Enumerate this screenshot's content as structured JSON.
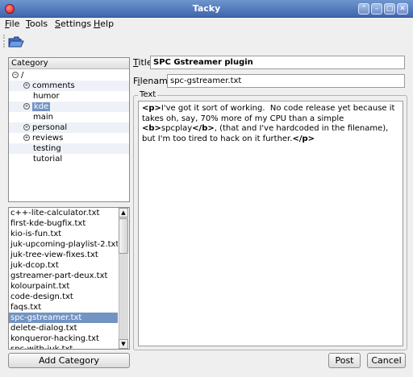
{
  "window": {
    "title": "Tacky"
  },
  "menu": [
    {
      "ul": "F",
      "rest": "ile"
    },
    {
      "ul": "T",
      "rest": "ools"
    },
    {
      "ul": "S",
      "rest": "ettings"
    },
    {
      "ul": "H",
      "rest": "elp"
    }
  ],
  "category": {
    "header": "Category",
    "root": "/",
    "items": [
      "comments",
      "humor",
      "kde",
      "main",
      "personal",
      "reviews",
      "testing",
      "tutorial"
    ]
  },
  "files": [
    "c++-lite-calculator.txt",
    "first-kde-bugfix.txt",
    "kio-is-fun.txt",
    "juk-upcoming-playlist-2.txt",
    "juk-tree-view-fixes.txt",
    "juk-dcop.txt",
    "gstreamer-part-deux.txt",
    "kolourpaint.txt",
    "code-design.txt",
    "faqs.txt",
    "spc-gstreamer.txt",
    "delete-dialog.txt",
    "konqueror-hacking.txt",
    "spc-with-juk.txt"
  ],
  "buttons": {
    "add_category": "Add Category",
    "post": "Post",
    "cancel": "Cancel"
  },
  "fields": {
    "title_label_ul": "T",
    "title_label_rest": "itle",
    "title_value": "SPC Gstreamer plugin",
    "filename_label_pre": "F",
    "filename_label_ul": "i",
    "filename_label_rest": "lename",
    "filename_value": "spc-gstreamer.txt",
    "text_label": "Text",
    "text_parts": {
      "p_open": "<p>",
      "t1": "I've got it sort of working.  No code release yet because it takes oh, say, 70% more of my CPU than a simple ",
      "b_open": "<b>",
      "t2": "spcplay",
      "b_close": "</b>",
      "t3": ", (that and I've hardcoded in the filename), but I'm too tired to hack on it further.",
      "p_close": "</p>"
    }
  },
  "colors": {
    "titlebar": "#4f76bd",
    "selection": "#7394c3"
  }
}
